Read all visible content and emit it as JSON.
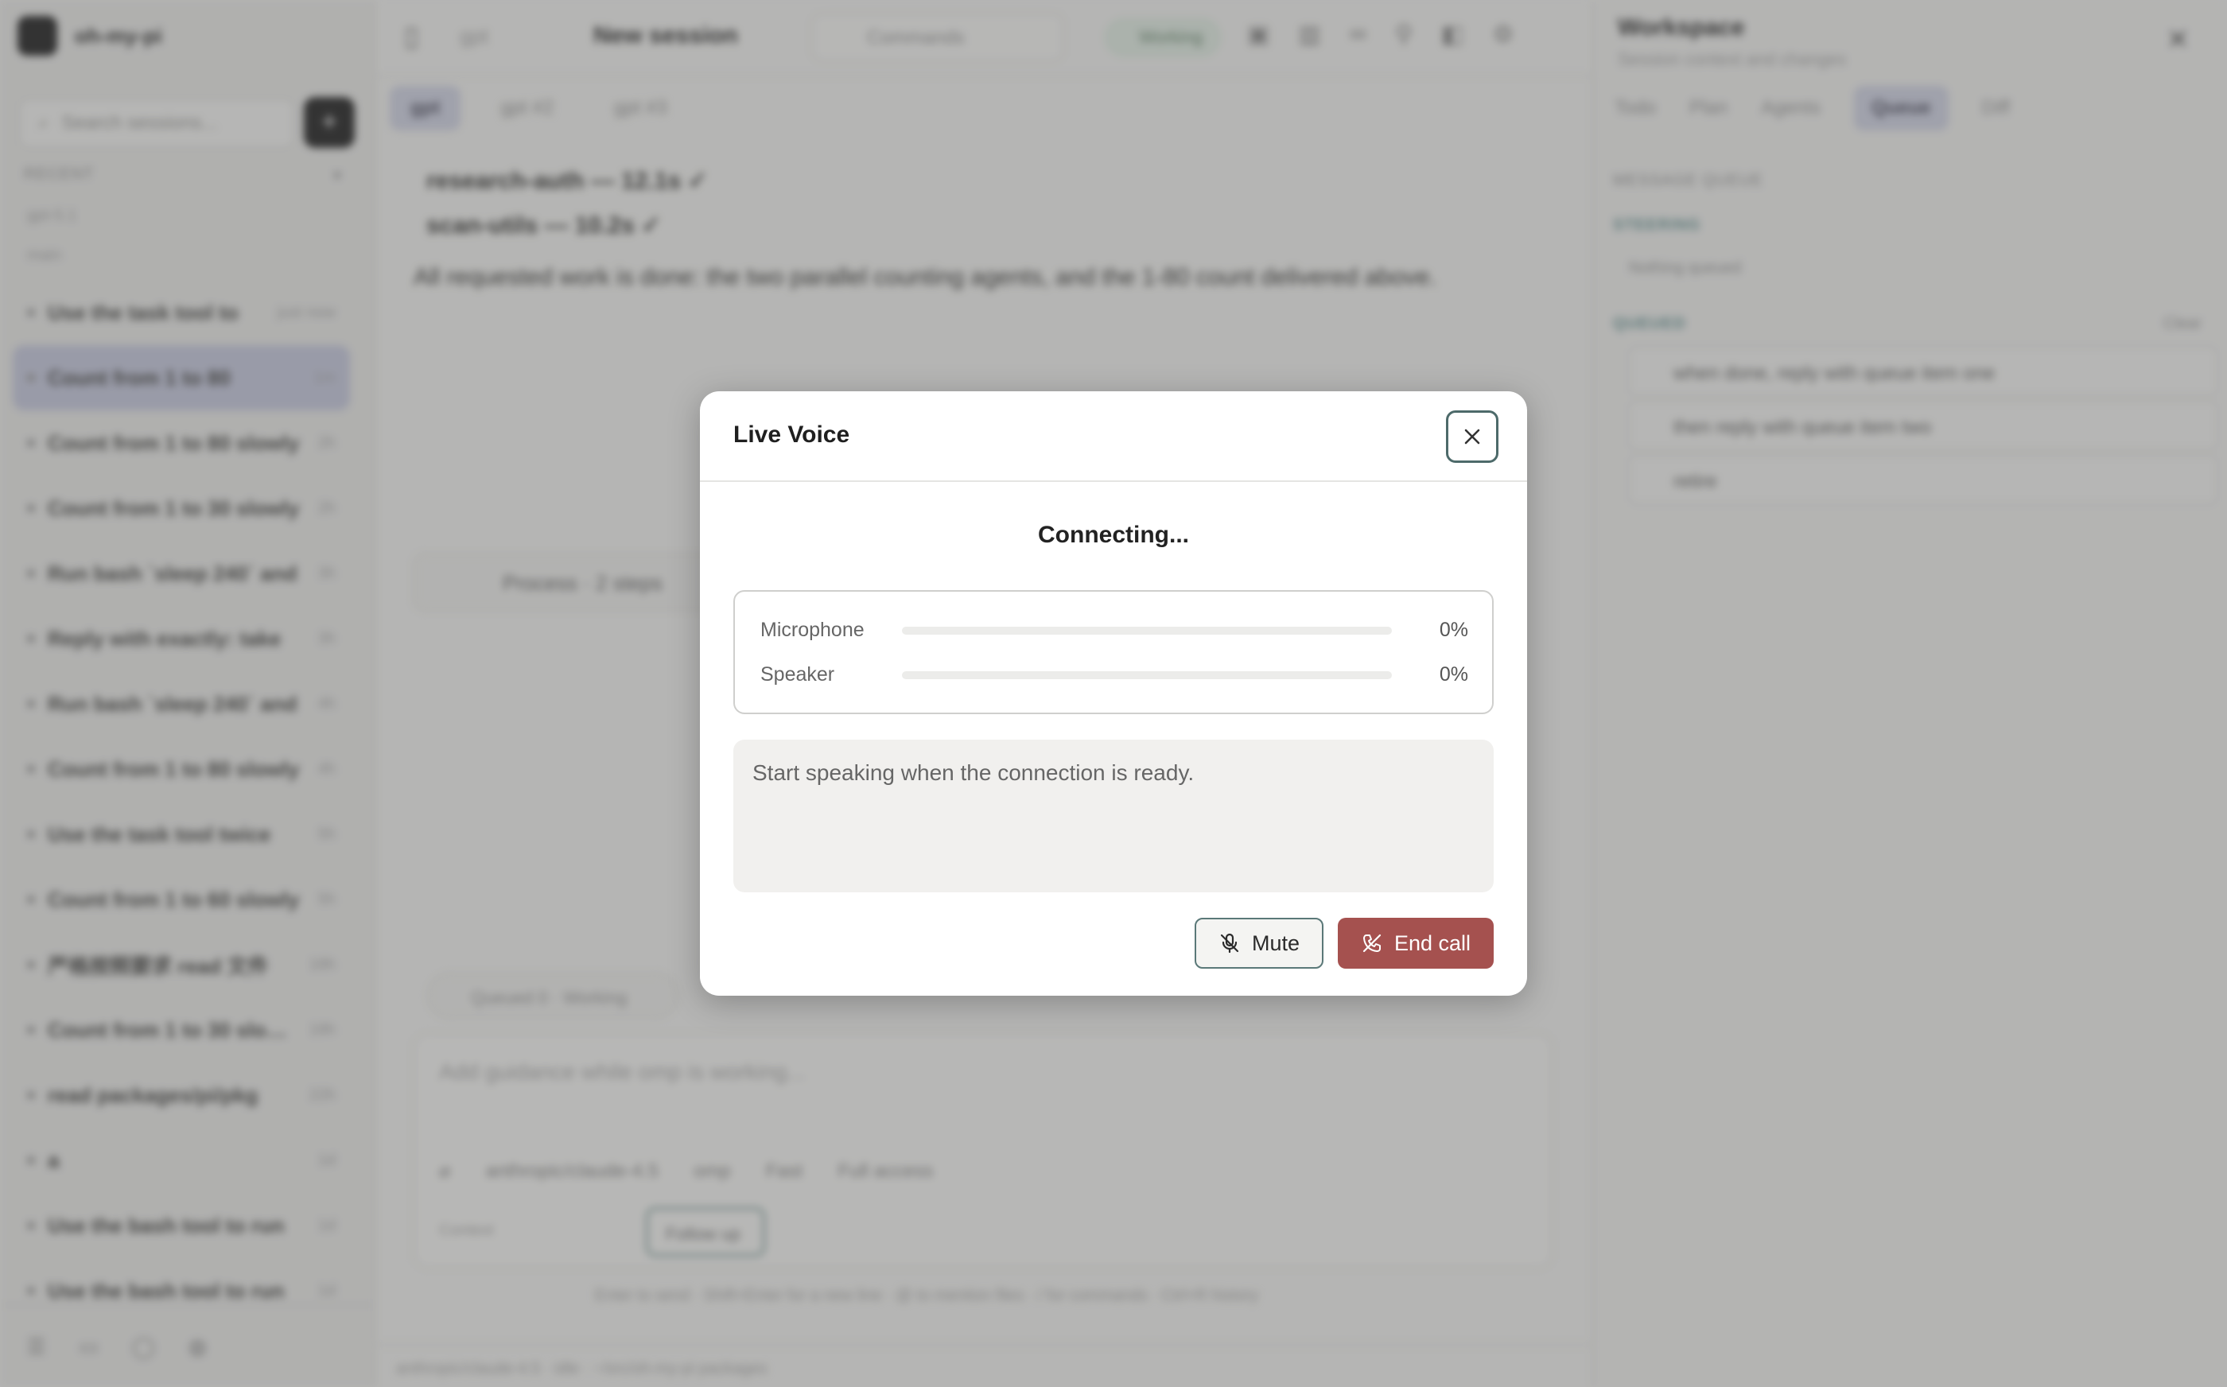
{
  "app": {
    "brand": "oh-my-pi",
    "sidebar": {
      "search_placeholder": "Search sessions...",
      "new_label": "+",
      "section_label": "RECENT",
      "group_1": "gpt-5.1",
      "group_2": "main",
      "sessions": [
        {
          "title": "Use the task tool to",
          "ago": "just now"
        },
        {
          "title": "Count from 1 to 80",
          "ago": "1m",
          "active": true
        },
        {
          "title": "Count from 1 to 80 slowly",
          "ago": "2h"
        },
        {
          "title": "Count from 1 to 30 slowly",
          "ago": "2h"
        },
        {
          "title": "Run bash `sleep 240` and",
          "ago": "3h"
        },
        {
          "title": "Reply with exactly: take",
          "ago": "3h"
        },
        {
          "title": "Run bash `sleep 240` and",
          "ago": "4h"
        },
        {
          "title": "Count from 1 to 80 slowly",
          "ago": "4h"
        },
        {
          "title": "Use the task tool twice",
          "ago": "5h"
        },
        {
          "title": "Count from 1 to 60 slowly",
          "ago": "5h"
        },
        {
          "title": "严格按照要求 read 文件",
          "ago": "18h"
        },
        {
          "title": "Count from 1 to 30 slowly",
          "ago": "18h"
        },
        {
          "title": "read packages/pi/pkg",
          "ago": "22h"
        },
        {
          "title": "a",
          "ago": "1d"
        },
        {
          "title": "Use the bash tool to run",
          "ago": "1d"
        },
        {
          "title": "Use the bash tool to run",
          "ago": "1d"
        }
      ]
    },
    "topbar": {
      "crumb": "gpt",
      "title": "New session",
      "commands_label": "Commands",
      "working_label": "Working"
    },
    "tabs": [
      "gpt",
      "gpt #2",
      "gpt #3"
    ],
    "chat": {
      "bullet_1": "research-auth — 12.1s ✓",
      "bullet_2": "scan-utils — 10.2s ✓",
      "summary": "All requested work is done: the two parallel counting agents, and the 1-80 count delivered above.",
      "process_label": "Process · 2 steps",
      "pill_label": "Queued 0 · Working",
      "composer_placeholder": "Add guidance while omp is working...",
      "model_label": "anthropic/claude-4.5",
      "mode_label": "omp",
      "fast_label": "Fast",
      "access_label": "Full access",
      "follow_label": "Follow up",
      "context_label": "Context",
      "hint": "Enter to send · Shift+Enter for a new line · @ to mention files · / for commands · Ctrl+R history",
      "status": "anthropic/claude-4.5 · idle · ~/src/oh-my-pi packages"
    },
    "right_panel": {
      "title": "Workspace",
      "subtitle": "Session context and changes",
      "tabs": [
        "Todo",
        "Plan",
        "Agents",
        "Queue",
        "Diff"
      ],
      "active_tab": "Queue",
      "sec_message": "MESSAGE QUEUE",
      "sec_steering": "STEERING",
      "steering_empty": "Nothing queued",
      "sec_queued": "QUEUED",
      "clear_label": "Clear",
      "queued": [
        "when done, reply with queue item one",
        "then reply with queue item two",
        "retire"
      ]
    }
  },
  "dialog": {
    "title": "Live Voice",
    "status": "Connecting...",
    "levels": [
      {
        "label": "Microphone",
        "value": 0,
        "display": "0%"
      },
      {
        "label": "Speaker",
        "value": 0,
        "display": "0%"
      }
    ],
    "transcript_placeholder": "Start speaking when the connection is ready.",
    "mute_label": "Mute",
    "end_call_label": "End call",
    "colors": {
      "end_call": "#a5514f",
      "focus_ring": "#4d6a6a"
    },
    "icons": {
      "close": "close-icon",
      "mute": "mic-off-icon",
      "end_call": "phone-off-icon"
    }
  }
}
